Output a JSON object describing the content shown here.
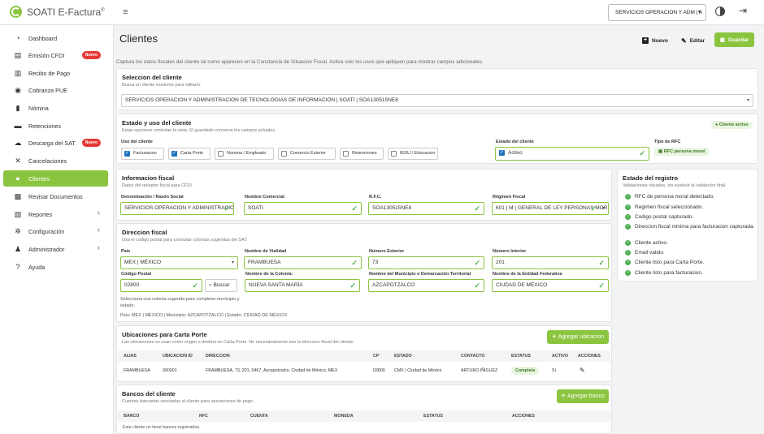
{
  "app": {
    "title": "SOATI E-Factura",
    "reg": "®"
  },
  "header": {
    "company_select": "SERVICIOS OPERACION Y ADM | A"
  },
  "sidebar": {
    "items": [
      {
        "label": "Dashboard",
        "icon": "dashboard-icon",
        "glyph": "◔"
      },
      {
        "label": "Emisión CFDI",
        "icon": "wallet-icon",
        "glyph": "▤",
        "badge": "Nuevo"
      },
      {
        "label": "Recibo de Pago",
        "icon": "receipt-icon",
        "glyph": "▥"
      },
      {
        "label": "Cobranza PUE",
        "icon": "coin-icon",
        "glyph": "◉"
      },
      {
        "label": "Nómina",
        "icon": "document-icon",
        "glyph": "▮"
      },
      {
        "label": "Retenciones",
        "icon": "id-card-icon",
        "glyph": "▬"
      },
      {
        "label": "Descarga del SAT",
        "icon": "cloud-download-icon",
        "glyph": "☁",
        "badge": "Nuevo"
      },
      {
        "label": "Cancelaciones",
        "icon": "close-icon",
        "glyph": "✕"
      },
      {
        "label": "Clientes",
        "icon": "user-icon",
        "glyph": "●",
        "active": true
      },
      {
        "label": "Revisar Documentos",
        "icon": "search-doc-icon",
        "glyph": "▩"
      },
      {
        "label": "Reportes",
        "icon": "report-icon",
        "glyph": "▧",
        "chevron": "‹"
      },
      {
        "label": "Configuración",
        "icon": "gear-icon",
        "glyph": "✲",
        "chevron": "‹"
      },
      {
        "label": "Administrador",
        "icon": "users-gear-icon",
        "glyph": "♟",
        "chevron": "‹"
      },
      {
        "label": "Ayuda",
        "icon": "help-icon",
        "glyph": "?"
      }
    ]
  },
  "page": {
    "title": "Clientes",
    "new_label": "Nuevo",
    "edit_label": "Editar",
    "save_label": "Guardar",
    "hint": "Captura los datos fiscales del cliente tal como aparecen en la Constancia de Situacion Fiscal. Activa solo los usos que apliquen para mostrar campos adicionales."
  },
  "seleccion": {
    "title": "Seleccion del cliente",
    "subtitle": "Busca un cliente existente para editarlo.",
    "value": "SERVICIOS OPERACION Y ADMINISTRACION DE TECNOLOGIAS DE INFORMACION | SOATI | SOA130515NE8"
  },
  "estado": {
    "title": "Estado y uso del cliente",
    "subtitle": "Estas opciones controlan la vista. El guardado conserva los campos actuales.",
    "badge": "Cliente activo",
    "uso_label": "Uso del cliente",
    "usos": [
      {
        "label": "Facturacion",
        "checked": true
      },
      {
        "label": "Carta Porte",
        "checked": true
      },
      {
        "label": "Nomina / Empleado",
        "checked": false
      },
      {
        "label": "Comercio Exterior",
        "checked": false
      },
      {
        "label": "Retenciones",
        "checked": false
      },
      {
        "label": "IEDU / Educacion",
        "checked": false
      }
    ],
    "estado_label": "Estado del cliente",
    "estado_value": "Activo",
    "tipo_label": "Tipo de RFC",
    "tipo_value": "RFC persona moral"
  },
  "fiscal": {
    "title": "Informacion fiscal",
    "subtitle": "Datos del receptor fiscal para CFDI.",
    "fields": [
      {
        "label": "Denominación / Razón Social",
        "value": "SERVICIOS OPERACION Y ADMINISTRACIO"
      },
      {
        "label": "Nombre Comercial",
        "value": "SOATI"
      },
      {
        "label": "R.F.C.",
        "value": "SOA130515NE8"
      },
      {
        "label": "Régimen Fiscal",
        "value": "601 | M | GENERAL DE LEY PERSONAS MOR..."
      }
    ]
  },
  "direccion": {
    "title": "Direccion fiscal",
    "subtitle": "Usa el codigo postal para consultar colonias sugeridas del SAT.",
    "row1": [
      {
        "label": "País",
        "value": "MEX | MÉXICO"
      },
      {
        "label": "Nombre de Vialidad",
        "value": "FRAMBUESA"
      },
      {
        "label": "Número Exterior",
        "value": "73"
      },
      {
        "label": "Número Interior",
        "value": "201"
      }
    ],
    "cp_label": "Código Postal",
    "cp_value": "02800",
    "buscar": "Buscar",
    "row2": [
      {
        "label": "Nombre de la Colonia:",
        "value": "NUEVA SANTA MARÍA"
      },
      {
        "label": "Nombre del Municipio o Demarcación Territorial",
        "value": "AZCAPOTZALCO"
      },
      {
        "label": "Nombre de la Entidad Federativa",
        "value": "CIUDAD DE MÉXICO"
      }
    ],
    "help": "Selecciona una colonia sugerida para completar municipio y estado.",
    "summary": "País: MEX | MÉXICO | Municipio: AZCAPOTZALCO | Estado: CIUDAD DE MÉXICO"
  },
  "registro": {
    "title": "Estado del registro",
    "subtitle": "Validaciones visuales, sin sustituir la validacion final.",
    "items": [
      "RFC de persona moral detectado.",
      "Regimen fiscal seleccionado.",
      "Codigo postal capturado.",
      "Direccion fiscal minima para facturacion capturada.",
      "Cliente activo.",
      "Email valido.",
      "Cliente listo para Carta Porte.",
      "Cliente listo para facturacion."
    ]
  },
  "ubicaciones": {
    "title": "Ubicaciones para Carta Porte",
    "subtitle": "Las ubicaciones se usan como origen o destino en Carta Porte. No necesariamente son la direccion fiscal del cliente.",
    "add": "Agregar ubicacion",
    "headers": [
      "ALIAS",
      "UBICACION ID",
      "DIRECCION",
      "CP",
      "ESTADO",
      "CONTACTO",
      "ESTATUS",
      "ACTIVO",
      "ACCIONES"
    ],
    "rows": [
      [
        "FRAMBUESA",
        "000001",
        "FRAMBUESA, 73, 201, 0467, Azcapotzalco, Ciudad de México, MEX",
        "02800",
        "CMX | Ciudad de México",
        "ARTURO IÑIGUEZ",
        "Completa",
        "Sí"
      ]
    ]
  },
  "bancos": {
    "title": "Bancos del cliente",
    "subtitle": "Cuentas bancarias asociadas al cliente para operaciones de pago.",
    "add": "Agregar banco",
    "headers": [
      "BANCO",
      "RFC",
      "CUENTA",
      "MONEDA",
      "ESTATUS",
      "ACCIONES"
    ],
    "empty": "Este cliente no tiene bancos registrados."
  }
}
